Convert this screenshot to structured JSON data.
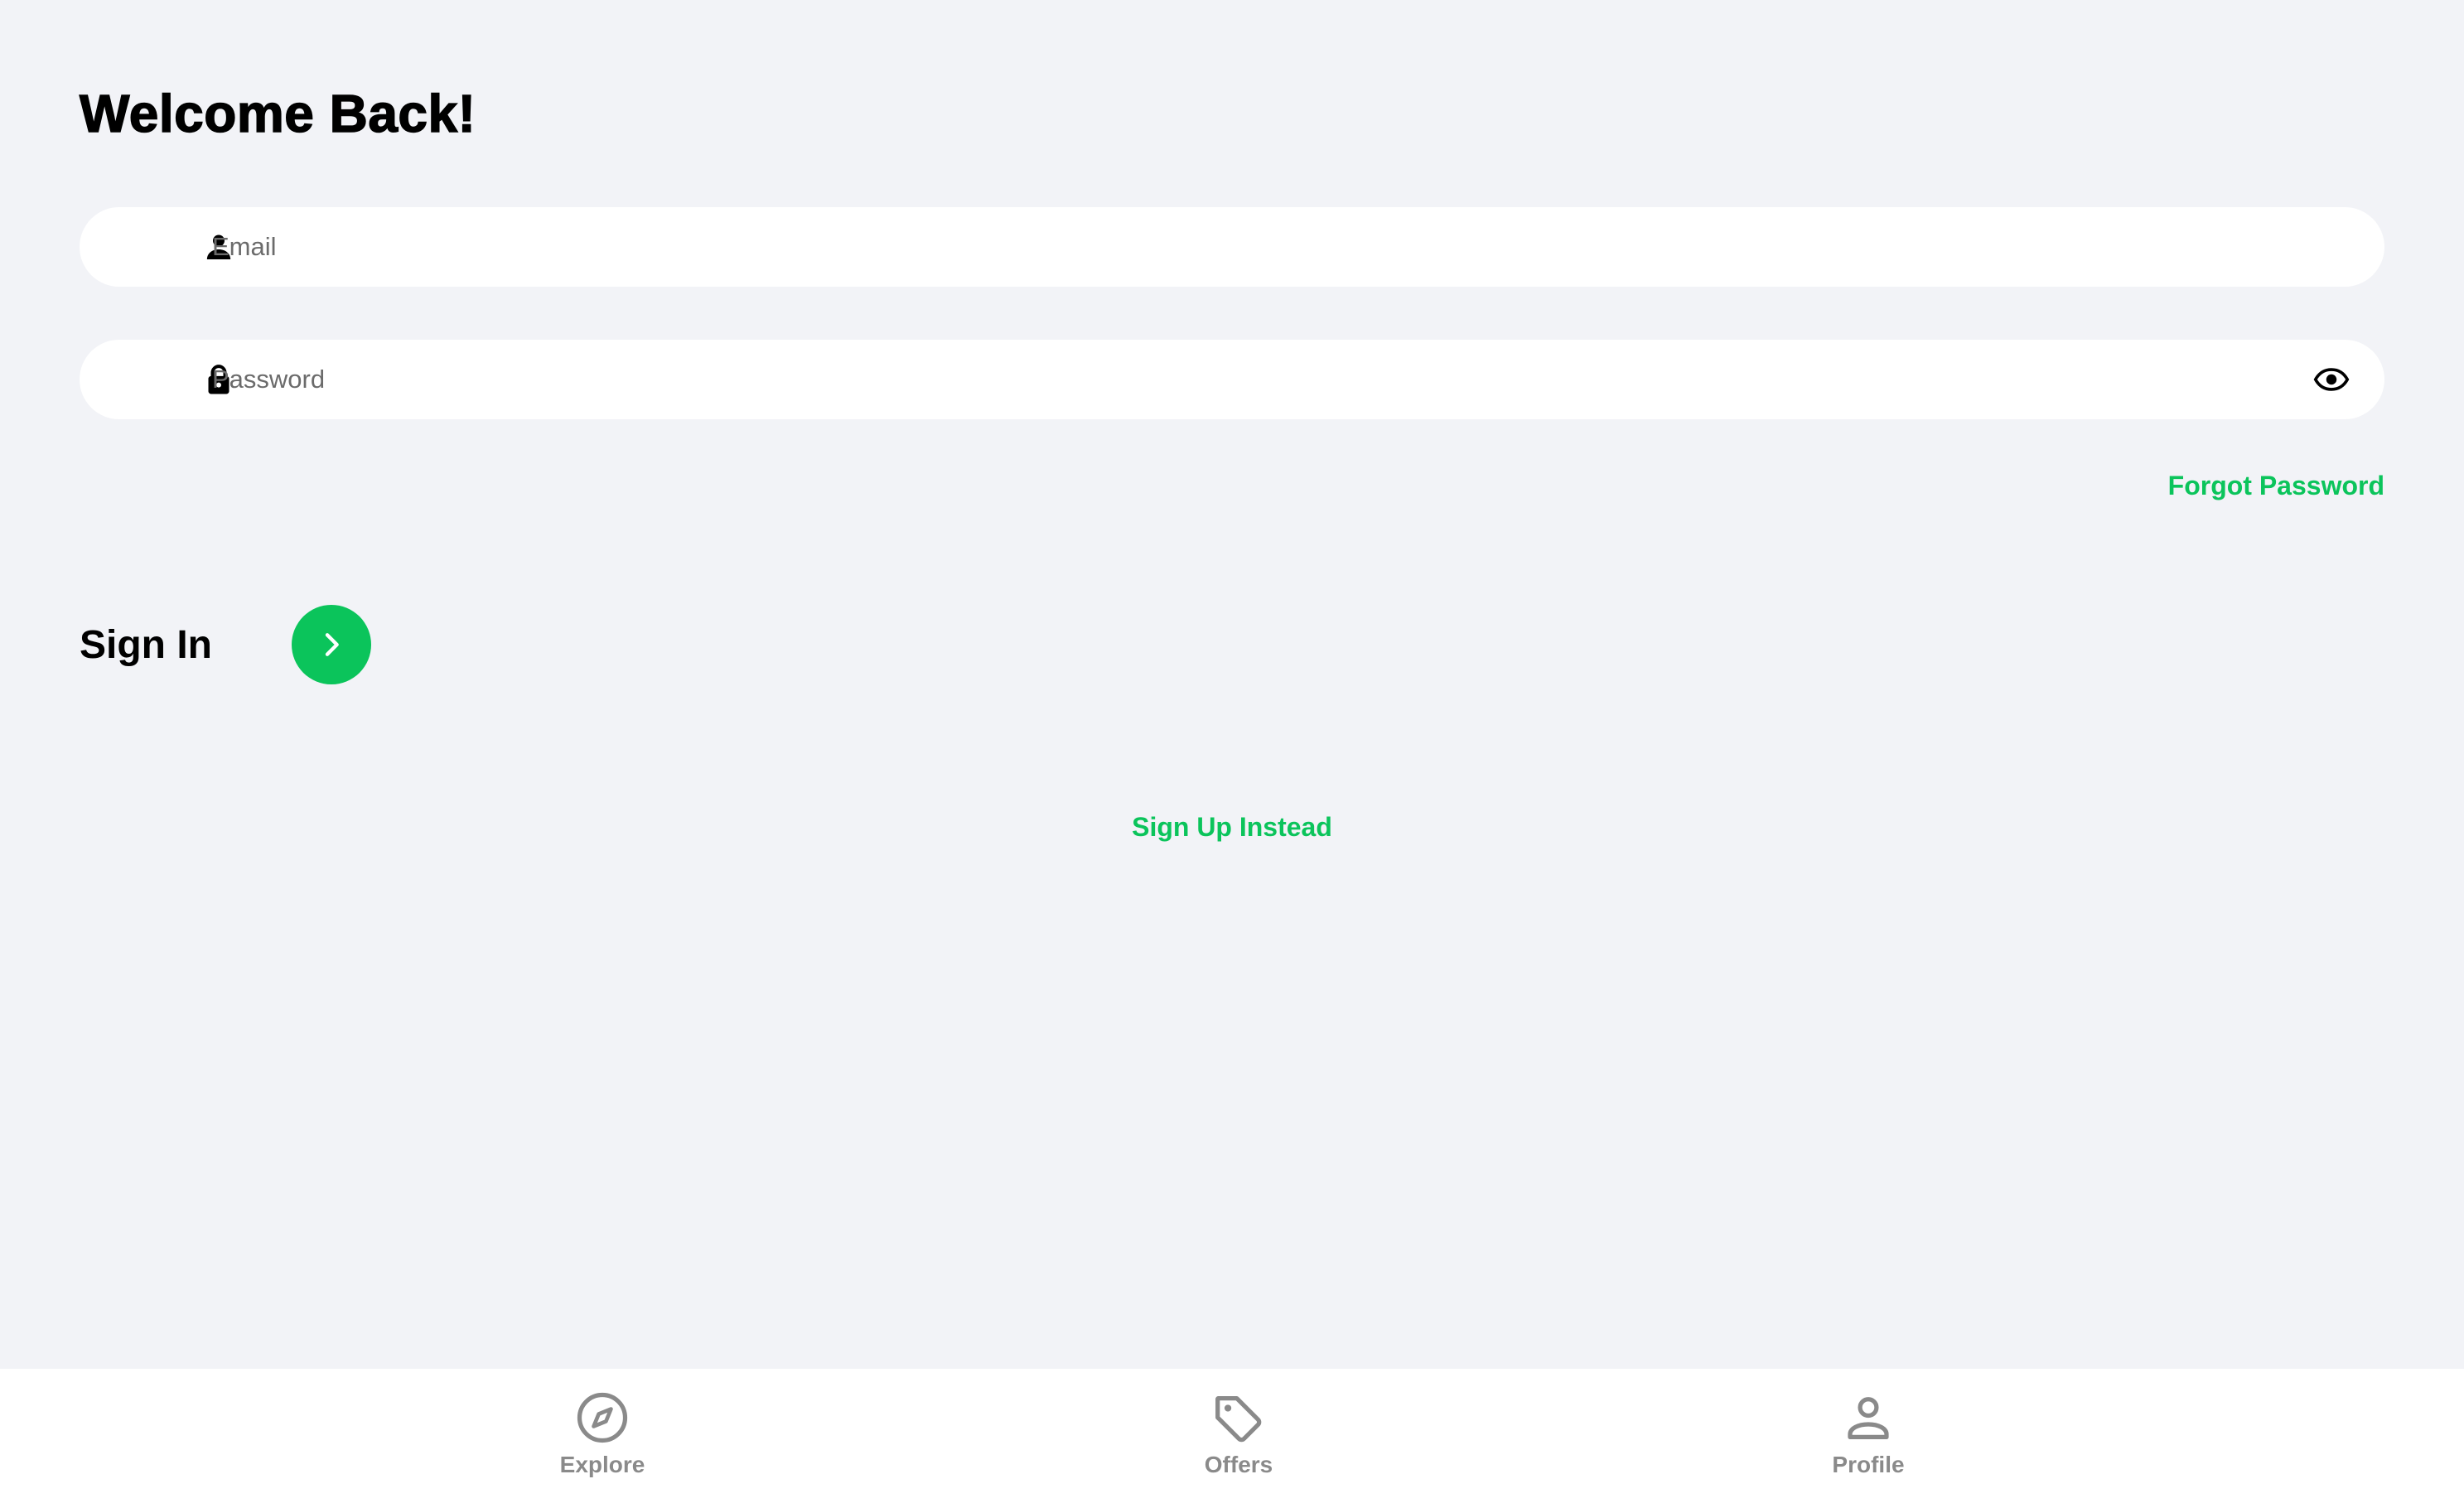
{
  "colors": {
    "background": "#f2f3f7",
    "accent": "#0bc45b",
    "tab_inactive": "#8a8a8a"
  },
  "header": {
    "title": "Welcome Back!"
  },
  "form": {
    "email": {
      "placeholder": "Email",
      "value": "",
      "icon": "person-icon"
    },
    "password": {
      "placeholder": "Password",
      "value": "",
      "icon": "lock-icon",
      "toggle_icon": "eye-icon"
    },
    "forgot_password_label": "Forgot Password",
    "sign_in_label": "Sign In",
    "sign_in_button_icon": "chevron-right-icon",
    "sign_up_label": "Sign Up Instead"
  },
  "tabbar": {
    "tabs": [
      {
        "label": "Explore",
        "icon": "compass-icon"
      },
      {
        "label": "Offers",
        "icon": "tag-icon"
      },
      {
        "label": "Profile",
        "icon": "person-outline-icon"
      }
    ]
  }
}
